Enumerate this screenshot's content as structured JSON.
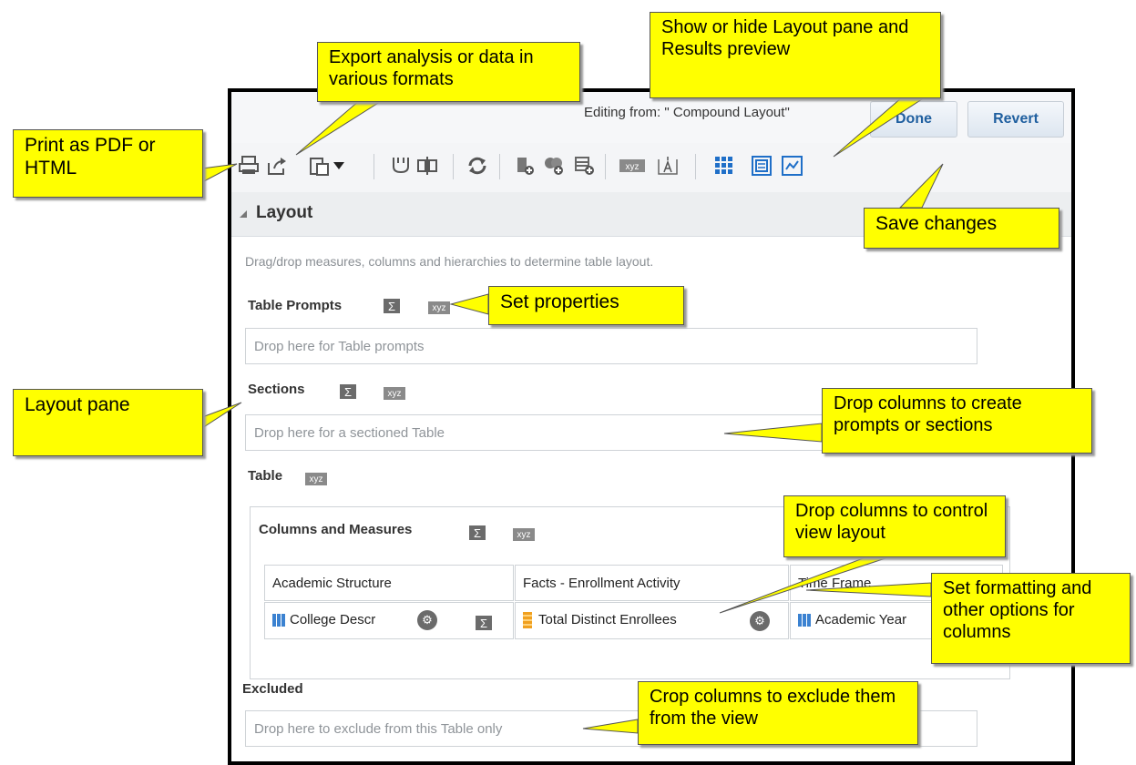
{
  "header": {
    "editing_from": "Editing from: \" Compound Layout\"",
    "done_label": "Done",
    "revert_label": "Revert"
  },
  "toolbar": {
    "icons": [
      "print-icon",
      "export-icon",
      "paste-icon",
      "dropdown-arrow-icon",
      "exclude-icon",
      "swap-icon",
      "refresh-icon",
      "add-column-icon",
      "add-measure-icon",
      "add-row-icon",
      "xyz-icon",
      "text-icon",
      "layout-pane-icon",
      "results-preview-icon",
      "save-icon"
    ]
  },
  "layout": {
    "title": "Layout",
    "description": "Drag/drop measures, columns and hierarchies to determine table layout.",
    "table_prompts_label": "Table Prompts",
    "table_prompts_drop": "Drop here for Table prompts",
    "sections_label": "Sections",
    "sections_drop": "Drop here for a sectioned Table",
    "table_label": "Table",
    "columns_measures_label": "Columns and Measures",
    "columns": [
      {
        "header": "Academic Structure",
        "value": "College Descr"
      },
      {
        "header": "Facts - Enrollment Activity",
        "value": "Total Distinct Enrollees"
      },
      {
        "header": "Time Frame",
        "value": "Academic Year"
      }
    ],
    "excluded_label": "Excluded",
    "excluded_drop": "Drop here to exclude from this Table only",
    "sigma": "Σ",
    "xyz": "xyz"
  },
  "callouts": {
    "export": "Export analysis or data in various formats",
    "show_hide": "Show or hide Layout pane and Results preview",
    "print": "Print as PDF or HTML",
    "save": "Save changes",
    "set_properties": "Set properties",
    "layout_pane": "Layout pane",
    "drop_prompts": "Drop columns to create prompts or sections",
    "drop_view": "Drop columns to control view layout",
    "set_formatting": "Set formatting and other options for columns",
    "crop": "Crop columns to exclude them from the view"
  },
  "colors": {
    "callout": "#ffff00",
    "accent": "#1f5f9f"
  }
}
